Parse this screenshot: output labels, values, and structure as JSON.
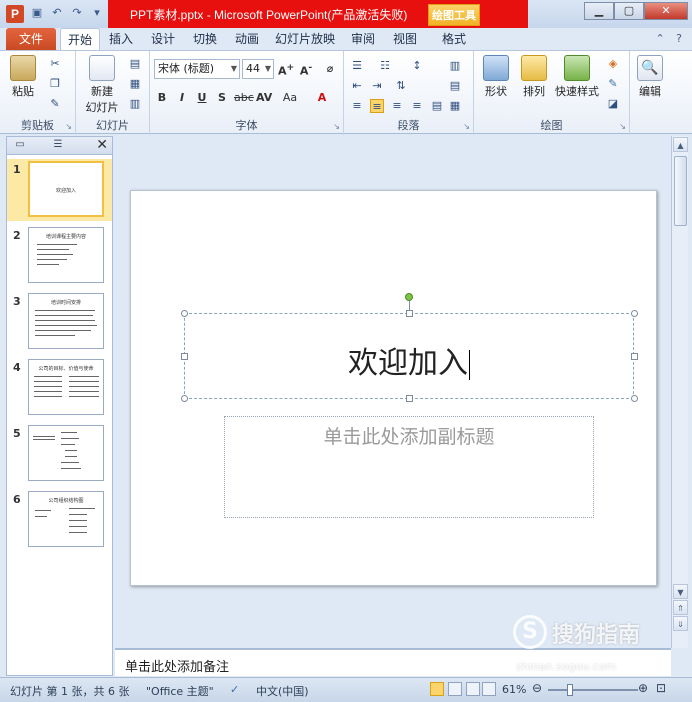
{
  "window": {
    "title": "PPT素材.pptx - Microsoft PowerPoint(产品激活失败)",
    "tools_tab": "绘图工具"
  },
  "ribbon_tabs": [
    "文件",
    "开始",
    "插入",
    "设计",
    "切换",
    "动画",
    "幻灯片放映",
    "审阅",
    "视图",
    "格式"
  ],
  "ribbon": {
    "clipboard": {
      "paste": "粘贴",
      "label": "剪贴板"
    },
    "slides": {
      "new_slide_line1": "新建",
      "new_slide_line2": "幻灯片",
      "label": "幻灯片"
    },
    "font": {
      "name": "宋体 (标题)",
      "size": "44",
      "label": "字体"
    },
    "paragraph": {
      "label": "段落"
    },
    "drawing": {
      "shapes": "形状",
      "arrange": "排列",
      "quick_styles": "快速样式",
      "label": "绘图"
    },
    "editing": {
      "edit": "编辑"
    }
  },
  "thumbnails": [
    {
      "num": "1",
      "title": "欢迎加入"
    },
    {
      "num": "2",
      "title": "培训课程主要内容"
    },
    {
      "num": "3",
      "title": "培训时间安排"
    },
    {
      "num": "4",
      "title": "公司的目标、价值与使命"
    },
    {
      "num": "5",
      "title": ""
    },
    {
      "num": "6",
      "title": "公司组织结构图"
    }
  ],
  "slide": {
    "title": "欢迎加入",
    "subtitle_placeholder": "单击此处添加副标题"
  },
  "notes_placeholder": "单击此处添加备注",
  "status": {
    "slide_info": "幻灯片 第 1 张，共 6 张",
    "theme": "\"Office 主题\"",
    "language": "中文(中国)",
    "zoom": "61%"
  },
  "watermark": {
    "logo": "S",
    "text": "搜狗指南",
    "url": "zhinan.sogou.com"
  }
}
